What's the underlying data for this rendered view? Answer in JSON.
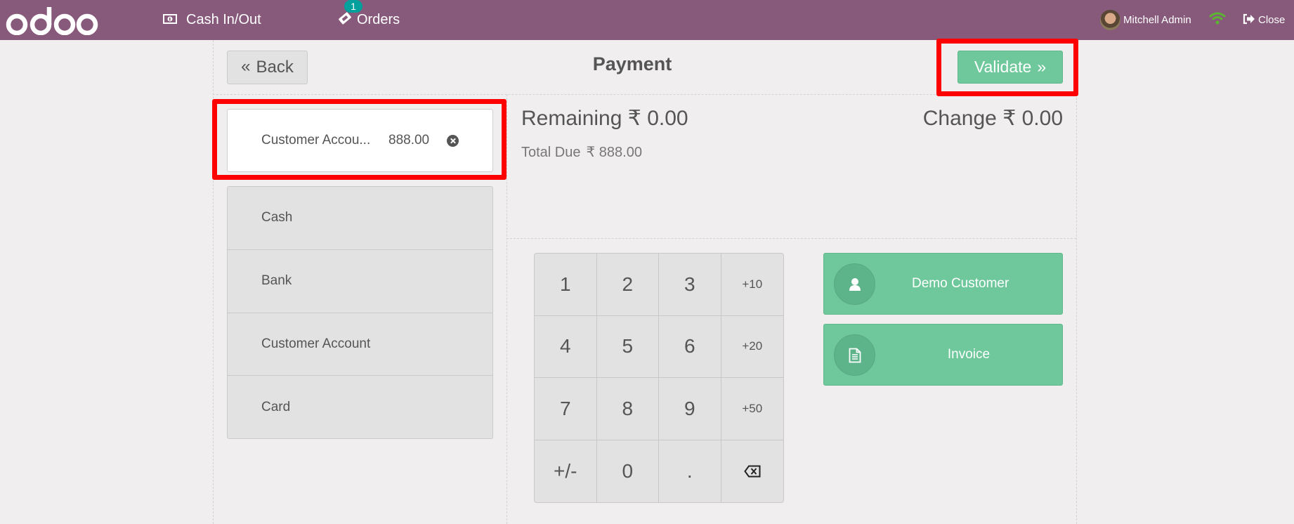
{
  "header": {
    "logo_text": "odoo",
    "cash_in_out_label": "Cash In/Out",
    "orders_label": "Orders",
    "orders_badge": "1",
    "user_name": "Mitchell Admin",
    "close_label": "Close",
    "brand_color": "#875a7b",
    "connection_color": "#5cb531"
  },
  "topbar": {
    "back_label": "Back",
    "title": "Payment",
    "validate_label": "Validate"
  },
  "payment_lines": [
    {
      "name": "Customer Accou...",
      "amount": "888.00"
    }
  ],
  "payment_methods": [
    "Cash",
    "Bank",
    "Customer Account",
    "Card"
  ],
  "status": {
    "remaining_label": "Remaining",
    "remaining_value": "₹ 0.00",
    "total_due_label": "Total Due",
    "total_due_value": "₹ 888.00",
    "change_label": "Change",
    "change_value": "₹ 0.00"
  },
  "numpad": {
    "keys": [
      "1",
      "2",
      "3",
      "+10",
      "4",
      "5",
      "6",
      "+20",
      "7",
      "8",
      "9",
      "+50",
      "+/-",
      "0",
      ".",
      "backspace"
    ]
  },
  "actions": {
    "customer_label": "Demo Customer",
    "invoice_label": "Invoice",
    "accent_color": "#6ec89b"
  },
  "highlight_color": "#ff0000"
}
